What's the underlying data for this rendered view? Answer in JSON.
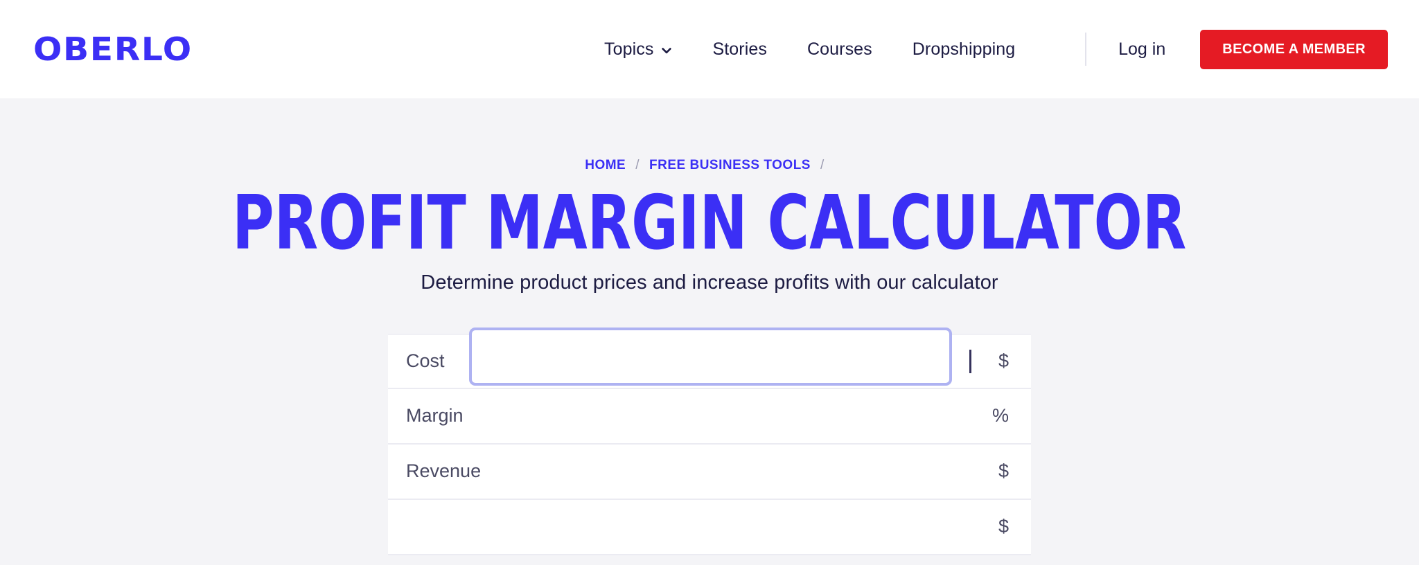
{
  "brand": {
    "name": "OBERLO",
    "color": "#3b2ff5"
  },
  "nav": {
    "items": [
      {
        "label": "Topics",
        "icon": "chevron-down-icon",
        "has_dropdown": true
      },
      {
        "label": "Stories",
        "has_dropdown": false
      },
      {
        "label": "Courses",
        "has_dropdown": false
      },
      {
        "label": "Dropshipping",
        "has_dropdown": false
      }
    ],
    "login_label": "Log in",
    "cta_label": "BECOME A MEMBER",
    "cta_color": "#e51b24"
  },
  "breadcrumb": {
    "items": [
      {
        "label": "HOME"
      },
      {
        "label": "FREE BUSINESS TOOLS"
      }
    ],
    "separator": "/",
    "trailing_separator": "/",
    "link_color": "#3b2ff5"
  },
  "hero": {
    "title": "PROFIT MARGIN CALCULATOR",
    "subtitle": "Determine product prices and increase profits with our calculator"
  },
  "calculator": {
    "rows": [
      {
        "label": "Cost",
        "value": "",
        "placeholder": "",
        "suffix": "$",
        "focused": true
      },
      {
        "label": "Margin",
        "value": "",
        "placeholder": "",
        "suffix": "%",
        "focused": false
      },
      {
        "label": "Revenue",
        "value": "",
        "placeholder": "",
        "suffix": "$",
        "focused": false
      },
      {
        "label": "",
        "value": "",
        "placeholder": "",
        "suffix": "$",
        "focused": false
      }
    ],
    "focus_ring_color": "#aeb2f2"
  },
  "theme": {
    "page_background": "#f4f4f7",
    "header_background": "#ffffff",
    "text_dark": "#1c1b42"
  }
}
